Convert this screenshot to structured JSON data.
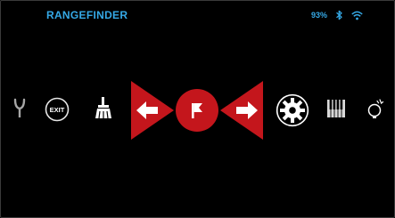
{
  "header": {
    "title": "RANGEFINDER",
    "battery_percent": "93%",
    "bluetooth_icon": "bluetooth-icon",
    "wifi_icon": "wifi-icon",
    "accent_color": "#35a9e6"
  },
  "menu": {
    "exit_label": "EXIT",
    "highlight_color": "#c4161c",
    "items": [
      {
        "name": "tuning-fork-icon"
      },
      {
        "name": "exit-button"
      },
      {
        "name": "broom-icon"
      },
      {
        "name": "previous-arrow-button"
      },
      {
        "name": "flag-icon",
        "selected": true
      },
      {
        "name": "next-arrow-button"
      },
      {
        "name": "settings-gear-icon"
      },
      {
        "name": "piano-keys-icon"
      },
      {
        "name": "lightbulb-icon"
      }
    ]
  }
}
